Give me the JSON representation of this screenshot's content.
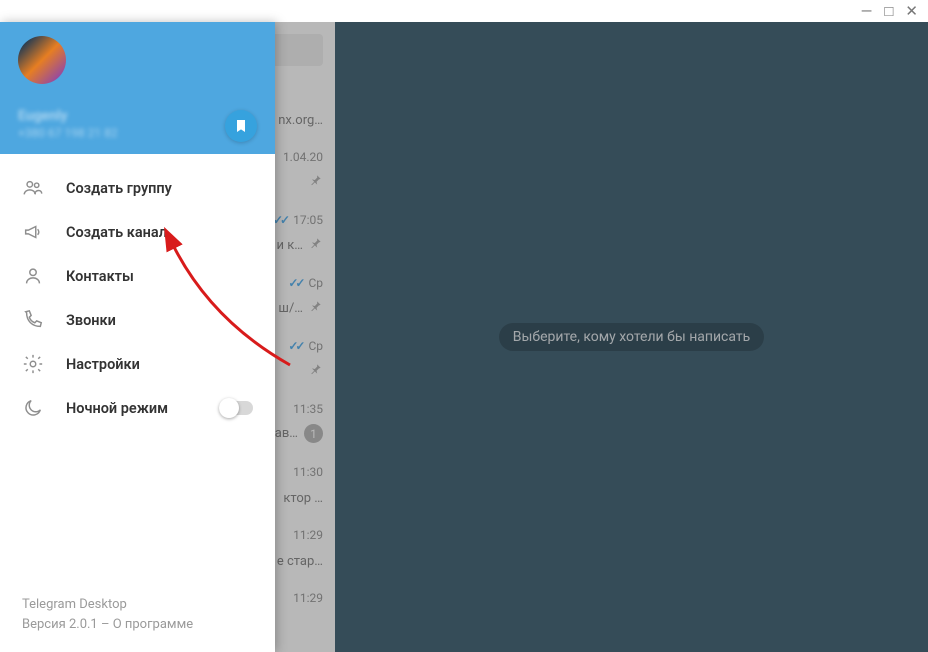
{
  "window": {
    "min": "—",
    "max": "□",
    "close": "✕"
  },
  "profile": {
    "name": "Eugenly",
    "phone": "+380 67 198 21 82"
  },
  "menu": {
    "new_group": "Создать группу",
    "new_channel": "Создать канал",
    "contacts": "Контакты",
    "calls": "Звонки",
    "settings": "Настройки",
    "night_mode": "Ночной режим"
  },
  "footer": {
    "app": "Telegram Desktop",
    "version": "Версия 2.0.1 – О программе"
  },
  "main": {
    "placeholder": "Выберите, кому хотели бы написать"
  },
  "chats": [
    {
      "time": "",
      "sub": "nx.org…",
      "pinned": true,
      "ticks": false
    },
    {
      "time": "1.04.20",
      "sub": "",
      "pinned": true,
      "ticks": false
    },
    {
      "time": "17:05",
      "sub": "и к…",
      "pinned": true,
      "ticks": true
    },
    {
      "time": "Ср",
      "sub": "ш/…",
      "pinned": true,
      "ticks": true
    },
    {
      "time": "Ср",
      "sub": "",
      "pinned": true,
      "ticks": true
    },
    {
      "time": "11:35",
      "sub": "ав…",
      "badge": "1",
      "ticks": false
    },
    {
      "time": "11:30",
      "sub": "ктор …",
      "ticks": false
    },
    {
      "time": "11:29",
      "sub": "е стар…",
      "ticks": false
    },
    {
      "time": "11:29",
      "sub": "",
      "ticks": false
    }
  ]
}
